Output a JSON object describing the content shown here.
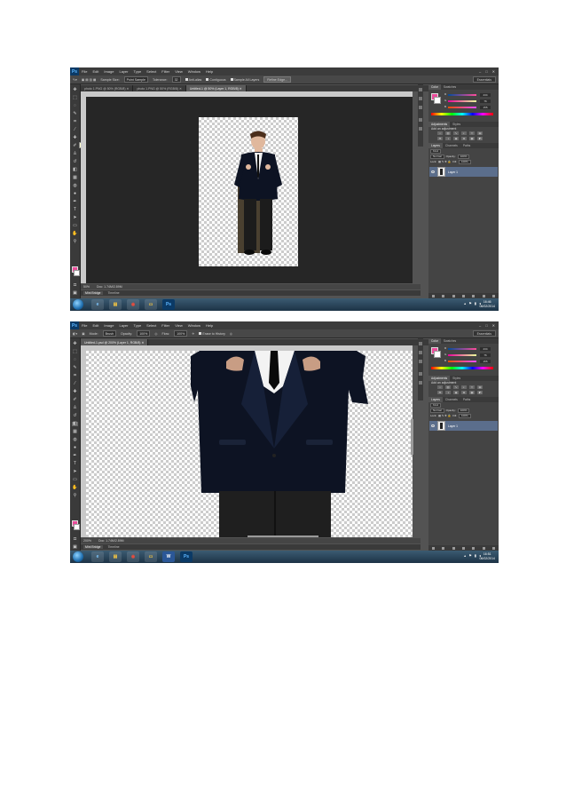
{
  "colors": {
    "foreground": "#ea4c9b",
    "background": "#ffffff",
    "workspace_bg": "#262626",
    "panel_bg": "#444444",
    "selected_layer": "#5b6e8c"
  },
  "common": {
    "menu": [
      "File",
      "Edit",
      "Image",
      "Layer",
      "Type",
      "Select",
      "Filter",
      "View",
      "Window",
      "Help"
    ],
    "workspace": "Essentials",
    "color_tabs": [
      "Color",
      "Swatches"
    ],
    "adjust_tabs": [
      "Adjustments",
      "Styles"
    ],
    "adjust_title": "Add an adjustment",
    "layers_tabs": [
      "Layers",
      "Channels",
      "Paths"
    ],
    "kind": "Kind",
    "blend": "Normal",
    "opacity_label": "Opacity:",
    "opacity": "100%",
    "lock_label": "Lock:",
    "fill_label": "Fill:",
    "fill": "100%",
    "layer_name": "Layer 1",
    "rgb": {
      "r": "234",
      "g": "76",
      "b": "155"
    },
    "timeline_tabs": [
      "Mini Bridge",
      "Timeline"
    ]
  },
  "shot1": {
    "options": {
      "sample_size_label": "Sample Size:",
      "sample_size": "Point Sample",
      "tolerance_label": "Tolerance:",
      "tolerance": "32",
      "anti_alias": "Anti-alias",
      "contiguous": "Contiguous",
      "sample_all": "Sample All Layers",
      "refine_edge": "Refine Edge..."
    },
    "tabs": [
      "photo 1.PNG @ 50% (RGB/8)",
      "photo 1.PNG @ 50% (RGB/8)",
      "Untitled-1 @ 50% (Layer 1, RGB/8)"
    ],
    "tooltip": "Crop Tool (C)",
    "status_zoom": "50%",
    "status_doc": "Doc: 1.74M/2.89M",
    "clock": {
      "time": "16:46",
      "date": "06/02/2014"
    }
  },
  "shot2": {
    "options": {
      "mode_label": "Mode:",
      "mode": "Brush",
      "opacity_label": "Opacity:",
      "opacity": "100%",
      "flow_label": "Flow:",
      "flow": "100%",
      "erase_history": "Erase to History"
    },
    "tabs": [
      "Untitled-1.psd @ 200% (Layer 1, RGB/8)"
    ],
    "status_zoom": "200%",
    "status_doc": "Doc: 1.74M/2.89M",
    "clock": {
      "time": "16:51",
      "date": "06/02/2014"
    }
  },
  "icons": {
    "tools": [
      "move-tool-icon",
      "marquee-tool-icon",
      "lasso-tool-icon",
      "quick-selection-tool-icon",
      "crop-tool-icon",
      "eyedropper-tool-icon",
      "healing-brush-icon",
      "brush-tool-icon",
      "clone-stamp-icon",
      "history-brush-icon",
      "eraser-tool-icon",
      "gradient-tool-icon",
      "blur-tool-icon",
      "dodge-tool-icon",
      "pen-tool-icon",
      "type-tool-icon",
      "path-selection-icon",
      "shape-tool-icon",
      "hand-tool-icon",
      "zoom-tool-icon"
    ],
    "taskbar": [
      "start-orb",
      "ie-icon",
      "explorer-icon",
      "chrome-icon",
      "folder-icon",
      "word-icon",
      "photoshop-icon"
    ]
  }
}
